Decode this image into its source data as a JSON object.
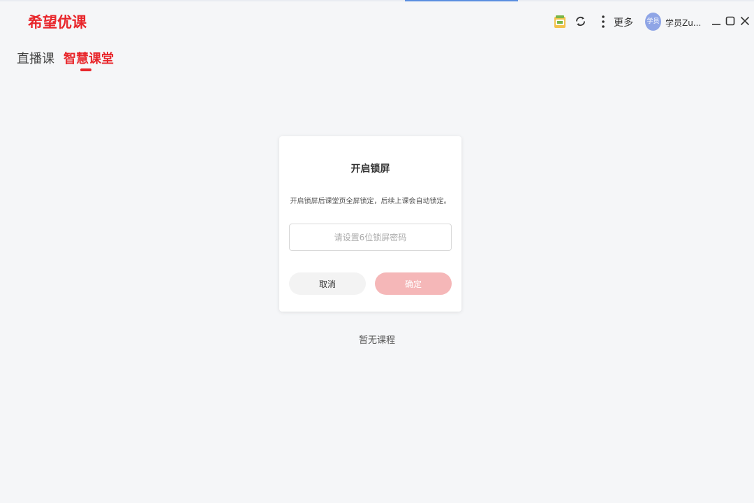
{
  "app": {
    "logo_text": "希望优课",
    "brand_color": "#e8262b"
  },
  "titlebar": {
    "vip_icon": "vip-badge-icon",
    "refresh_icon": "refresh-icon",
    "more_icon": "more-vertical-icon",
    "more_label": "更多",
    "avatar_text": "学员",
    "user_name": "学员Zu...",
    "window_controls": [
      "minimize-icon",
      "maximize-icon",
      "close-icon"
    ]
  },
  "tabs": [
    {
      "label": "直播课",
      "active": false
    },
    {
      "label": "智慧课堂",
      "active": true
    }
  ],
  "dialog": {
    "title": "开启锁屏",
    "description": "开启锁屏后课堂页全屏锁定，后续上课会自动锁定。",
    "password_placeholder": "请设置6位锁屏密码",
    "password_value": "",
    "cancel_label": "取消",
    "confirm_label": "确定",
    "confirm_disabled": true
  },
  "main": {
    "empty_text": "暂无课程"
  }
}
